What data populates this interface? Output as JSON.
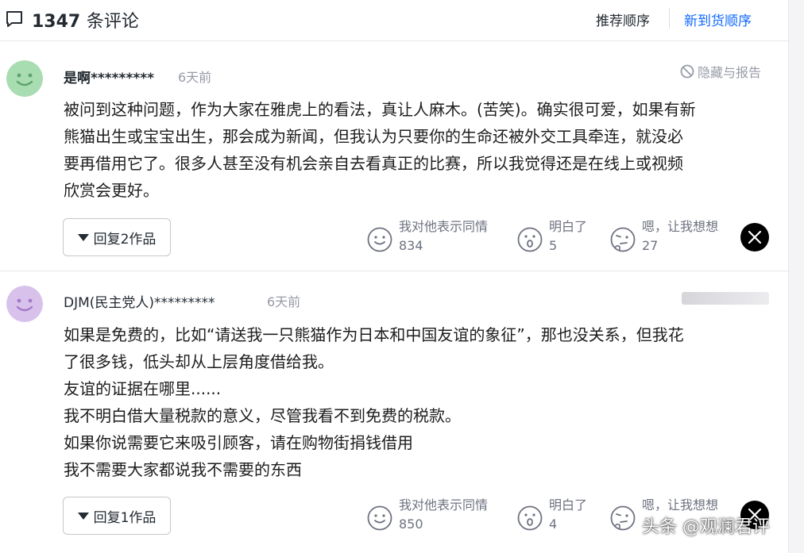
{
  "header": {
    "count": "1347",
    "count_suffix": "条评论",
    "sort_options": [
      "推荐顺序",
      "新到货顺序"
    ]
  },
  "colors": {
    "accent": "#0f69ff",
    "avatar_green": "#a8dcb1",
    "avatar_purple": "#d8c2ec"
  },
  "comments": [
    {
      "username": "是啊*********",
      "time": "6天前",
      "hide_report": "隐藏与报告",
      "body": [
        "被问到这种问题，作为大家在雅虎上的看法，真让人麻木。(苦笑)。确实很可爱，如果有新",
        "熊猫出生或宝宝出生，那会成为新闻，但我认为只要你的生命还被外交工具牵连，就没必",
        "要再借用它了。很多人甚至没有机会亲自去看真正的比赛，所以我觉得还是在线上或视频",
        "欣赏会更好。"
      ],
      "reply_label": "回复2作品",
      "reactions": [
        {
          "label": "我对他表示同情",
          "count": "834",
          "icon": "smile-face-icon"
        },
        {
          "label": "明白了",
          "count": "5",
          "icon": "surprised-face-icon"
        },
        {
          "label": "嗯，让我想想",
          "count": "27",
          "icon": "thinking-face-icon"
        }
      ]
    },
    {
      "username": "DJM(民主党人)*********",
      "time": "6天前",
      "body": [
        "如果是免费的，比如“请送我一只熊猫作为日本和中国友谊的象征”，那也没关系，但我花",
        "了很多钱，低头却从上层角度借给我。",
        "友谊的证据在哪里......",
        "我不明白借大量税款的意义，尽管我看不到免费的税款。",
        "如果你说需要它来吸引顾客，请在购物街捐钱借用",
        "我不需要大家都说我不需要的东西"
      ],
      "reply_label": "回复1作品",
      "reactions": [
        {
          "label": "我对他表示同情",
          "count": "850",
          "icon": "smile-face-icon"
        },
        {
          "label": "明白了",
          "count": "4",
          "icon": "surprised-face-icon"
        },
        {
          "label": "嗯，让我想想",
          "count": "",
          "icon": "thinking-face-icon"
        }
      ]
    }
  ],
  "watermark": "头条 @观澜君评"
}
